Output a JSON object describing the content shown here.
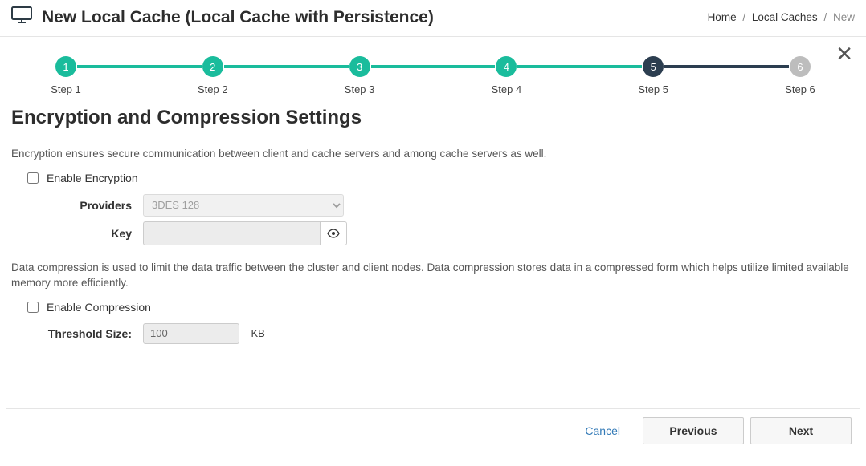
{
  "header": {
    "title": "New Local Cache (Local Cache with Persistence)",
    "breadcrumbs": {
      "home": "Home",
      "caches": "Local Caches",
      "current": "New"
    }
  },
  "stepper": {
    "steps": [
      {
        "num": "1",
        "label": "Step 1",
        "state": "done"
      },
      {
        "num": "2",
        "label": "Step 2",
        "state": "done"
      },
      {
        "num": "3",
        "label": "Step 3",
        "state": "done"
      },
      {
        "num": "4",
        "label": "Step 4",
        "state": "done"
      },
      {
        "num": "5",
        "label": "Step 5",
        "state": "active"
      },
      {
        "num": "6",
        "label": "Step 6",
        "state": "future"
      }
    ],
    "bars": [
      "done",
      "done",
      "done",
      "done",
      "active",
      "future"
    ]
  },
  "section": {
    "title": "Encryption and Compression Settings",
    "encryption_desc": "Encryption ensures secure communication between client and cache servers and among cache servers as well.",
    "enable_encryption_label": "Enable Encryption",
    "providers_label": "Providers",
    "provider_value": "3DES 128",
    "key_label": "Key",
    "key_value": "",
    "compression_desc": "Data compression is used to limit the data traffic between the cluster and client nodes. Data compression stores data in a compressed form which helps utilize limited available memory more efficiently.",
    "enable_compression_label": "Enable Compression",
    "threshold_label": "Threshold Size:",
    "threshold_value": "100",
    "threshold_unit": "KB"
  },
  "footer": {
    "cancel": "Cancel",
    "previous": "Previous",
    "next": "Next"
  }
}
